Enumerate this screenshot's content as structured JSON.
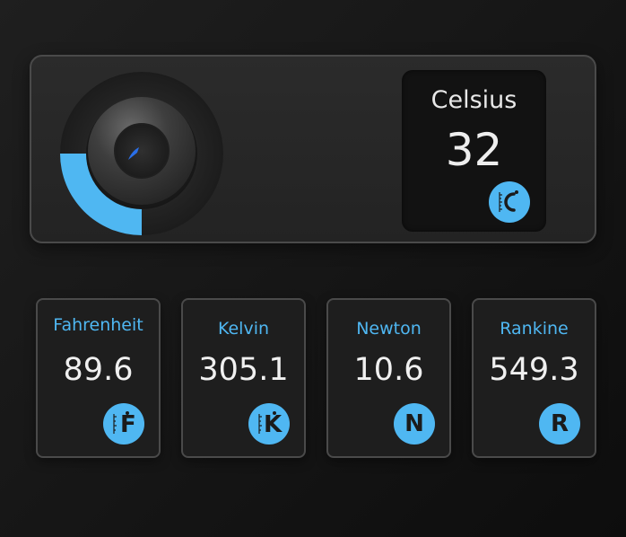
{
  "main": {
    "dial": {
      "fill_fraction": 0.25,
      "accent_color": "#4fb7f2",
      "pointer_color": "#2a6fe8",
      "icon": "thermostat-knob-icon"
    },
    "celsius": {
      "label": "Celsius",
      "value": "32",
      "icon": "celsius-thermometer-icon"
    }
  },
  "units": [
    {
      "name": "Fahrenheit",
      "value": "89.6",
      "letter": "F",
      "icon": "fahrenheit-thermometer-icon"
    },
    {
      "name": "Kelvin",
      "value": "305.1",
      "letter": "K",
      "icon": "kelvin-thermometer-icon"
    },
    {
      "name": "Newton",
      "value": "10.6",
      "letter": "N",
      "icon": "newton-letter-icon"
    },
    {
      "name": "Rankine",
      "value": "549.3",
      "letter": "R",
      "icon": "rankine-letter-icon"
    }
  ],
  "colors": {
    "accent": "#4fb7f2",
    "panel_border": "#4a4a4a",
    "background": "#1a1a1a"
  }
}
